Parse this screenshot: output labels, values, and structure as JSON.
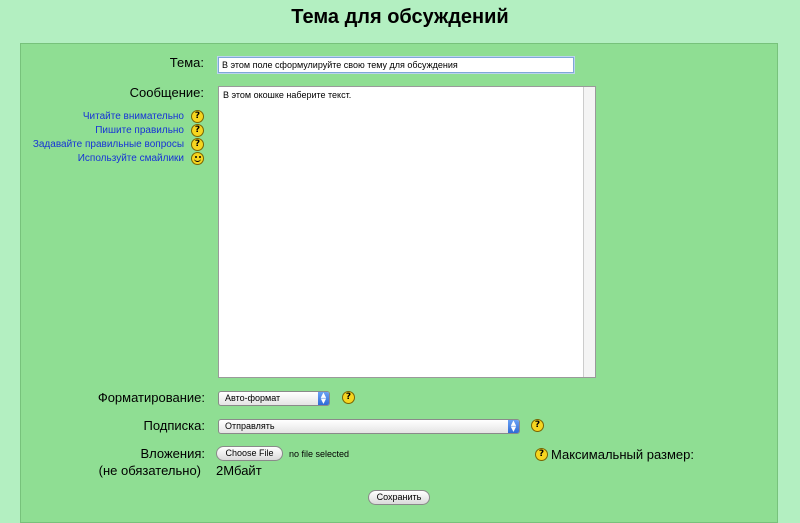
{
  "page": {
    "title": "Тема для обсуждений"
  },
  "form": {
    "topic_label": "Тема:",
    "topic_value": "В этом поле сформулируйте свою тему для обсуждения",
    "message_label": "Сообщение:",
    "message_value": "В этом окошке наберите текст.",
    "help_links": [
      {
        "label": "Читайте внимательно",
        "icon": "question-icon"
      },
      {
        "label": "Пишите правильно",
        "icon": "question-icon"
      },
      {
        "label": "Задавайте правильные вопросы",
        "icon": "question-icon"
      },
      {
        "label": "Используйте смайлики",
        "icon": "smiley-icon"
      }
    ],
    "format_label": "Форматирование:",
    "format_value": "Авто-формат",
    "subscription_label": "Подписка:",
    "subscription_value": "Отправлять",
    "attachments_label": "Вложения:",
    "attachments_optional": "(не обязательно)",
    "choose_file_label": "Choose File",
    "no_file_text": "no file selected",
    "max_size_label": "Максимальный размер:",
    "max_size_value": "2Мбайт",
    "save_label": "Сохранить"
  },
  "colors": {
    "background": "#b3efc1",
    "panel": "#8fde93",
    "link": "#1733d6",
    "help_icon": "#f6d51f"
  }
}
